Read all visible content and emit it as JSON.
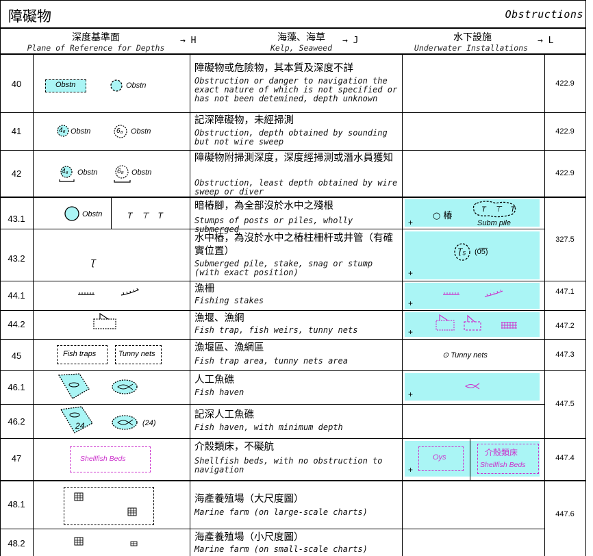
{
  "header": {
    "title_zh": "障礙物",
    "title_en": "Obstructions"
  },
  "columns": {
    "depth": {
      "zh": "深度基準面",
      "en": "Plane of Reference for Depths",
      "arrow": "→ H"
    },
    "kelp": {
      "zh": "海藻、海草",
      "en": "Kelp, Seaweed",
      "arrow": "→ J"
    },
    "install": {
      "zh": "水下設施",
      "en": "Underwater Installations",
      "arrow": "→ L"
    }
  },
  "rows": [
    {
      "num": "40",
      "zh": "障礙物或危險物，其本質及深度不詳",
      "en": "Obstruction or danger to navigation the exact nature of which is not specified or has not been detemined, depth unknown",
      "ref": "422.9",
      "sym": [
        "Obstn",
        "Obstn"
      ]
    },
    {
      "num": "41",
      "zh": "記深障礙物，未經掃測",
      "en": "Obstruction, depth obtained by sounding but not wire sweep",
      "ref": "422.9",
      "sym": [
        "4₆",
        "Obstn",
        "6₈",
        "Obstn"
      ]
    },
    {
      "num": "42",
      "zh": "障礙物附掃測深度，深度經掃測或潛水員獲知",
      "en": "Obstruction, least depth obtained by wire sweep or diver",
      "ref": "422.9",
      "sym": [
        "4₆",
        "Obstn",
        "6₈",
        "Obstn"
      ]
    },
    {
      "num": "43.1",
      "zh": "暗樁腳，為全部沒於水中之殘根",
      "en": "Stumps of posts or piles, wholly submerged",
      "ref": "",
      "sym": [
        "Obstn",
        "T ⊤ T"
      ],
      "install": [
        "○ 椿",
        "T ⊤ T",
        "Subm pile"
      ]
    },
    {
      "num": "43.2",
      "zh": "水中樁，為沒於水中之樁柱柵杆或井管（有確實位置）",
      "en": "Submerged pile, stake, snag or stump (with exact position)",
      "ref": "327.5",
      "sym": [
        "Ʈ"
      ],
      "install": [
        "Ʈ₅",
        "(0̅5̅)"
      ]
    },
    {
      "num": "44.1",
      "zh": "漁柵",
      "en": "Fishing stakes",
      "ref": "447.1"
    },
    {
      "num": "44.2",
      "zh": "漁堰、漁網",
      "en": "Fish trap, fish weirs, tunny nets",
      "ref": "447.2"
    },
    {
      "num": "45",
      "zh": "漁堰區、漁網區",
      "en": "Fish trap area, tunny nets area",
      "ref": "447.3",
      "sym": [
        "Fish traps",
        "Tunny nets"
      ],
      "install": [
        "⊙ Tunny nets"
      ]
    },
    {
      "num": "46.1",
      "zh": "人工魚礁",
      "en": "Fish haven",
      "ref": "447.5"
    },
    {
      "num": "46.2",
      "zh": "記深人工魚礁",
      "en": "Fish haven, with minimum depth",
      "ref": "",
      "sym": [
        "24",
        "(24)"
      ]
    },
    {
      "num": "47",
      "zh": "介殼類床，不礙航",
      "en": "Shellfish beds, with no obstruction to navigation",
      "ref": "447.4",
      "sym": [
        "Shellfish Beds"
      ],
      "install": [
        "Oys",
        "介殼類床",
        "Shellfish Beds"
      ]
    },
    {
      "num": "48.1",
      "zh": "海產養殖場（大尺度圖）",
      "en": "Marine farm (on large-scale charts)",
      "ref": "447.6"
    },
    {
      "num": "48.2",
      "zh": "海產養殖場（小尺度圖）",
      "en": "Marine farm (on small-scale charts)",
      "ref": ""
    }
  ],
  "colors": {
    "cyan": "#aaf5f5",
    "magenta": "#cc33cc"
  }
}
